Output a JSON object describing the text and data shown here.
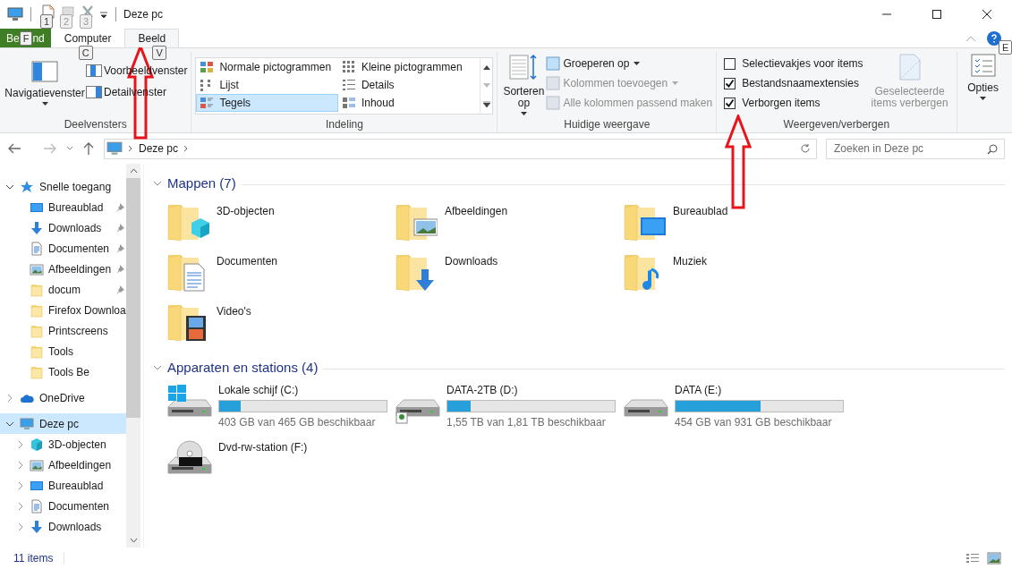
{
  "window": {
    "title": "Deze pc",
    "qat_keys": [
      "1",
      "2",
      "3"
    ],
    "help_key": "E"
  },
  "ribbon_tabs": [
    {
      "kind": "file",
      "label": "Be",
      "label_end": "nd",
      "key": "F",
      "selected": false
    },
    {
      "kind": "tab",
      "label": "Computer",
      "key": "C",
      "selected": false
    },
    {
      "kind": "tab",
      "label": "Beeld",
      "key": "V",
      "selected": true
    }
  ],
  "panes": {
    "label": "Deelvensters",
    "navigation": "Navigatievenster",
    "preview": "Voorbeeldvenster",
    "details": "Detailvenster"
  },
  "layout": {
    "label": "Indeling",
    "options": [
      {
        "label": "Normale pictogrammen",
        "selected": false
      },
      {
        "label": "Kleine pictogrammen",
        "selected": false
      },
      {
        "label": "Lijst",
        "selected": false
      },
      {
        "label": "Details",
        "selected": false
      },
      {
        "label": "Tegels",
        "selected": true
      },
      {
        "label": "Inhoud",
        "selected": false
      }
    ]
  },
  "current_view": {
    "label": "Huidige weergave",
    "sort": "Sorteren op",
    "commands": [
      {
        "label": "Groeperen op",
        "disabled": false
      },
      {
        "label": "Kolommen toevoegen",
        "disabled": true
      },
      {
        "label": "Alle kolommen passend maken",
        "disabled": true
      }
    ]
  },
  "show_hide": {
    "label": "Weergeven/verbergen",
    "checkboxes": [
      {
        "label": "Selectievakjes voor items",
        "checked": false
      },
      {
        "label": "Bestandsnaamextensies",
        "checked": true
      },
      {
        "label": "Verborgen items",
        "checked": true
      }
    ],
    "hide_selected": {
      "label": "Geselecteerde items verbergen",
      "disabled": true
    }
  },
  "options": {
    "label": "Opties"
  },
  "address": {
    "segments": [
      "Deze pc"
    ],
    "search_placeholder": "Zoeken in Deze pc"
  },
  "nav": [
    {
      "label": "Snelle toegang",
      "kind": "star",
      "expanded": true,
      "selected": false,
      "children": [
        {
          "label": "Bureaublad",
          "kind": "desktop",
          "pinned": true
        },
        {
          "label": "Downloads",
          "kind": "download",
          "pinned": true
        },
        {
          "label": "Documenten",
          "kind": "document",
          "pinned": true
        },
        {
          "label": "Afbeeldingen",
          "kind": "pictures",
          "pinned": true
        },
        {
          "label": "docum",
          "kind": "folder",
          "pinned": true
        },
        {
          "label": "Firefox Downloa",
          "kind": "folder",
          "pinned": false
        },
        {
          "label": "Printscreens",
          "kind": "folder",
          "pinned": false
        },
        {
          "label": "Tools",
          "kind": "folder",
          "pinned": false
        },
        {
          "label": "Tools Be",
          "kind": "folder",
          "pinned": false
        }
      ]
    },
    {
      "label": "OneDrive",
      "kind": "cloud",
      "expanded": false,
      "selected": false
    },
    {
      "label": "Deze pc",
      "kind": "pc",
      "expanded": true,
      "selected": true,
      "children": [
        {
          "label": "3D-objecten",
          "kind": "cube",
          "expanded": false
        },
        {
          "label": "Afbeeldingen",
          "kind": "pictures",
          "expanded": false
        },
        {
          "label": "Bureaublad",
          "kind": "desktop",
          "expanded": false
        },
        {
          "label": "Documenten",
          "kind": "document",
          "expanded": false
        },
        {
          "label": "Downloads",
          "kind": "download",
          "expanded": false
        }
      ]
    }
  ],
  "sections": [
    {
      "title": "Mappen (7)",
      "kind": "folders",
      "expanded": true,
      "items": [
        {
          "label": "3D-objecten",
          "kind": "cube"
        },
        {
          "label": "Afbeeldingen",
          "kind": "pictures"
        },
        {
          "label": "Bureaublad",
          "kind": "desktop"
        },
        {
          "label": "Documenten",
          "kind": "document"
        },
        {
          "label": "Downloads",
          "kind": "download"
        },
        {
          "label": "Muziek",
          "kind": "music"
        },
        {
          "label": "Video's",
          "kind": "video"
        }
      ]
    },
    {
      "title": "Apparaten en stations (4)",
      "kind": "drives",
      "expanded": true,
      "items": [
        {
          "label": "Lokale schijf (C:)",
          "kind": "system",
          "level": 0.13,
          "reading": "403 GB van 465 GB beschikbaar"
        },
        {
          "label": "DATA-2TB (D:)",
          "kind": "shared",
          "level": 0.14,
          "reading": "1,55 TB van 1,81 TB beschikbaar"
        },
        {
          "label": "DATA (E:)",
          "kind": "disk",
          "level": 0.51,
          "reading": "454 GB van 931 GB beschikbaar"
        },
        {
          "label": "Dvd-rw-station (F:)",
          "kind": "dvd"
        }
      ]
    }
  ],
  "annotations": [
    {
      "kind": "arrow"
    },
    {
      "kind": "arrow"
    }
  ],
  "status_bar": {
    "count": "11 items"
  }
}
